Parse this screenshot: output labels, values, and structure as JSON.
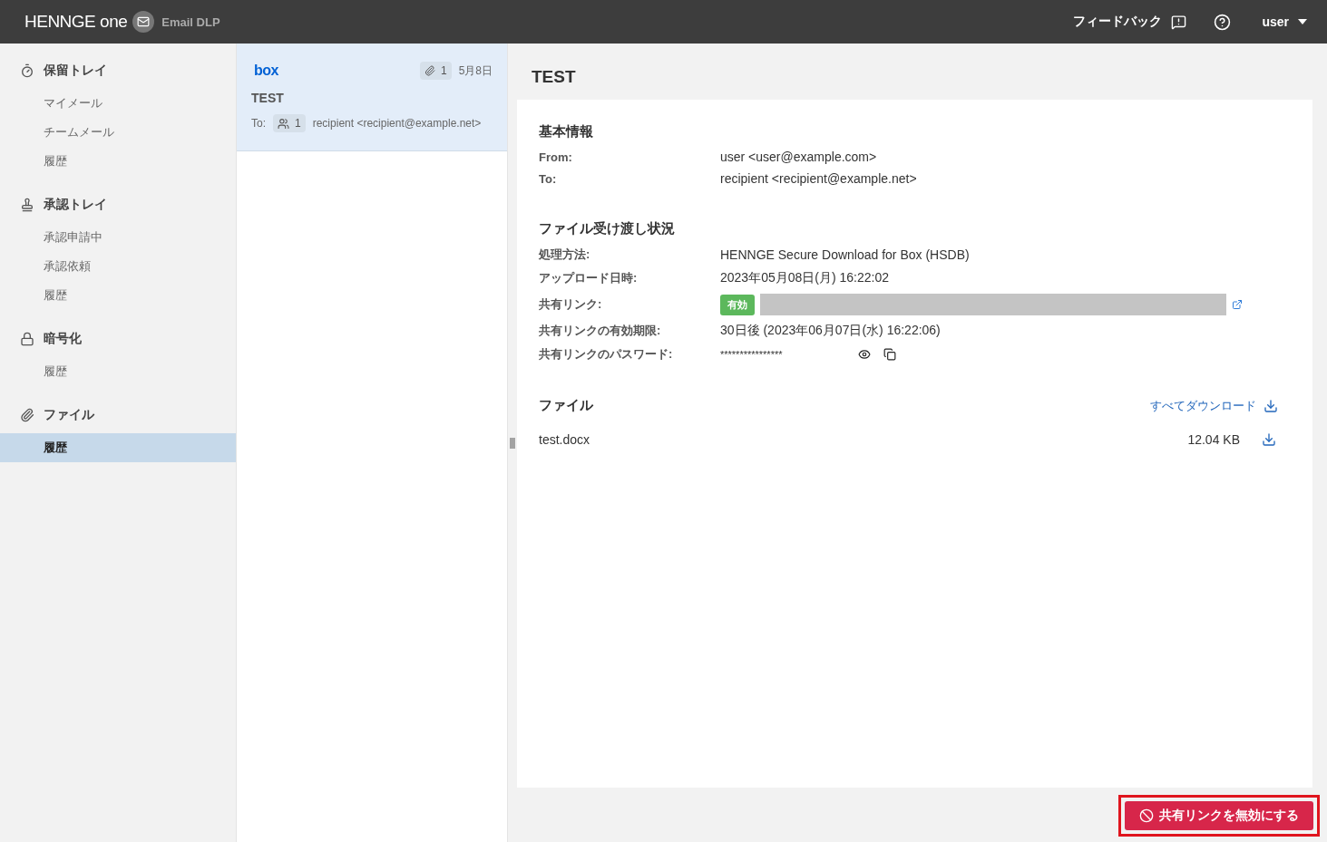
{
  "header": {
    "brand": "HENNGE one",
    "product": "Email DLP",
    "feedback": "フィードバック",
    "user": "user"
  },
  "sidebar": {
    "groups": [
      {
        "label": "保留トレイ",
        "kind": "timer",
        "items": [
          {
            "label": "マイメール",
            "selected": false
          },
          {
            "label": "チームメール",
            "selected": false
          },
          {
            "label": "履歴",
            "selected": false
          }
        ]
      },
      {
        "label": "承認トレイ",
        "kind": "stamp",
        "items": [
          {
            "label": "承認申請中",
            "selected": false
          },
          {
            "label": "承認依頼",
            "selected": false
          },
          {
            "label": "履歴",
            "selected": false
          }
        ]
      },
      {
        "label": "暗号化",
        "kind": "lock",
        "items": [
          {
            "label": "履歴",
            "selected": false
          }
        ]
      },
      {
        "label": "ファイル",
        "kind": "clip",
        "items": [
          {
            "label": "履歴",
            "selected": true
          }
        ]
      }
    ]
  },
  "mail_list": [
    {
      "service": "box",
      "attachments": "1",
      "date": "5月8日",
      "subject": "TEST",
      "to_label": "To:",
      "recipients": "1",
      "to": "recipient <recipient@example.net>",
      "selected": true
    }
  ],
  "detail": {
    "title": "TEST",
    "basic": {
      "heading": "基本情報",
      "rows": [
        {
          "label": "From:",
          "value": "user <user@example.com>"
        },
        {
          "label": "To:",
          "value": "recipient <recipient@example.net>"
        }
      ]
    },
    "transfer": {
      "heading": "ファイル受け渡し状況",
      "rows": [
        {
          "kind": "text",
          "label": "処理方法:",
          "value": "HENNGE Secure Download for Box (HSDB)"
        },
        {
          "kind": "text",
          "label": "アップロード日時:",
          "value": "2023年05月08日(月) 16:22:02"
        },
        {
          "kind": "link",
          "label": "共有リンク:",
          "status": "有効"
        },
        {
          "kind": "text",
          "label": "共有リンクの有効期限:",
          "value": "30日後 (2023年06月07日(水) 16:22:06)"
        },
        {
          "kind": "password",
          "label": "共有リンクのパスワード:",
          "value": "****************"
        }
      ]
    },
    "files": {
      "heading": "ファイル",
      "download_all": "すべてダウンロード",
      "items": [
        {
          "name": "test.docx",
          "size": "12.04 KB"
        }
      ]
    },
    "revoke": {
      "label": "共有リンクを無効にする",
      "highlighted": true
    }
  }
}
